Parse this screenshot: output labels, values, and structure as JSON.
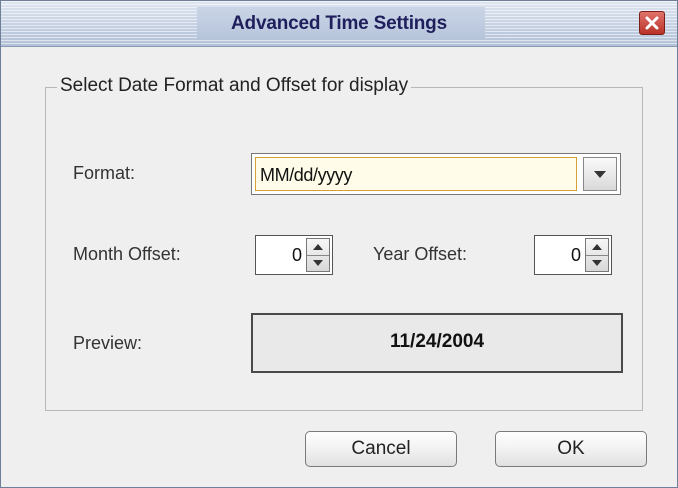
{
  "window": {
    "title": "Advanced Time Settings",
    "close_icon": "close-icon",
    "close_color": "#c4392f"
  },
  "group": {
    "legend": "Select Date Format and Offset for display"
  },
  "format": {
    "label": "Format:",
    "value": "MM/dd/yyyy",
    "arrow_icon": "chevron-down-icon"
  },
  "month_offset": {
    "label": "Month Offset:",
    "value": "0"
  },
  "year_offset": {
    "label": "Year Offset:",
    "value": "0"
  },
  "preview": {
    "label": "Preview:",
    "value": "11/24/2004"
  },
  "buttons": {
    "cancel": "Cancel",
    "ok": "OK"
  }
}
